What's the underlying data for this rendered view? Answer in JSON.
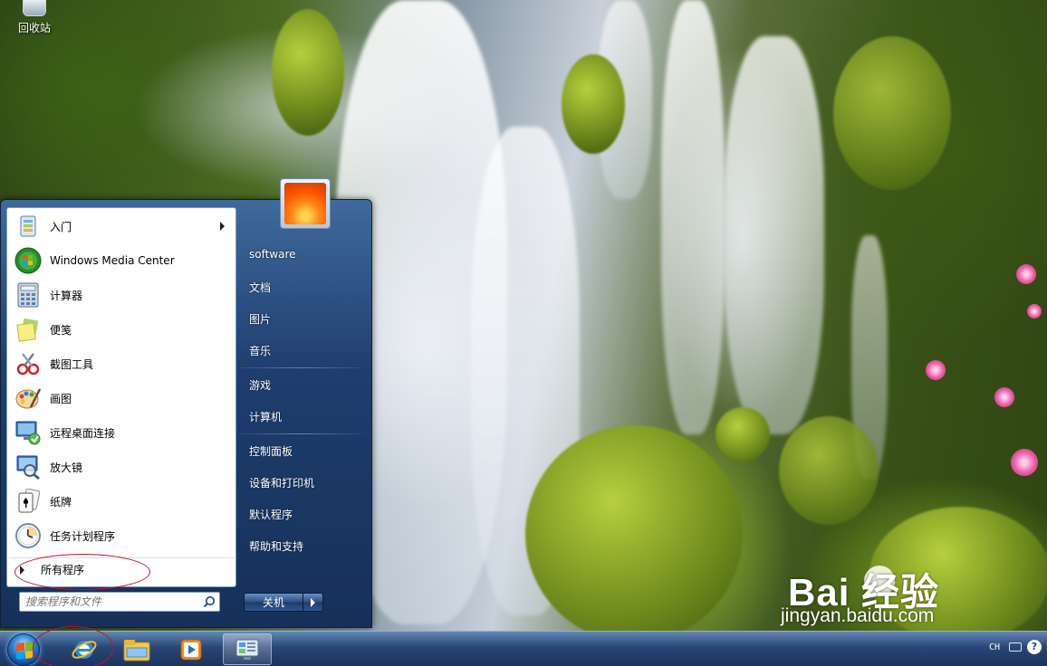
{
  "desktop": {
    "recycle_bin_label": "回收站",
    "watermark_brand": "Bai 经验",
    "watermark_url": "jingyan.baidu.com"
  },
  "start_menu": {
    "programs": [
      {
        "label": "入门",
        "icon": "getting-started-icon",
        "has_submenu": true
      },
      {
        "label": "Windows Media Center",
        "icon": "media-center-icon",
        "has_submenu": false
      },
      {
        "label": "计算器",
        "icon": "calculator-icon",
        "has_submenu": false
      },
      {
        "label": "便笺",
        "icon": "sticky-notes-icon",
        "has_submenu": false
      },
      {
        "label": "截图工具",
        "icon": "snipping-tool-icon",
        "has_submenu": false
      },
      {
        "label": "画图",
        "icon": "paint-icon",
        "has_submenu": false
      },
      {
        "label": "远程桌面连接",
        "icon": "remote-desktop-icon",
        "has_submenu": false
      },
      {
        "label": "放大镜",
        "icon": "magnifier-icon",
        "has_submenu": false
      },
      {
        "label": "纸牌",
        "icon": "solitaire-icon",
        "has_submenu": false
      },
      {
        "label": "任务计划程序",
        "icon": "task-scheduler-icon",
        "has_submenu": false
      }
    ],
    "all_programs_label": "所有程序",
    "search_placeholder": "搜索程序和文件",
    "right_items": [
      {
        "label": "software"
      },
      {
        "label": "文档"
      },
      {
        "label": "图片"
      },
      {
        "label": "音乐"
      },
      {
        "label": "游戏"
      },
      {
        "label": "计算机"
      },
      {
        "label": "控制面板"
      },
      {
        "label": "设备和打印机"
      },
      {
        "label": "默认程序"
      },
      {
        "label": "帮助和支持"
      }
    ],
    "shutdown_label": "关机"
  },
  "taskbar": {
    "pinned": [
      "internet-explorer-icon",
      "file-explorer-icon",
      "media-player-icon",
      "control-panel-icon"
    ],
    "tray": {
      "language": "CH",
      "help_glyph": "?"
    }
  },
  "colors": {
    "annotation_circle": "#c4122b",
    "start_menu_blue": "#1f3e6e"
  }
}
